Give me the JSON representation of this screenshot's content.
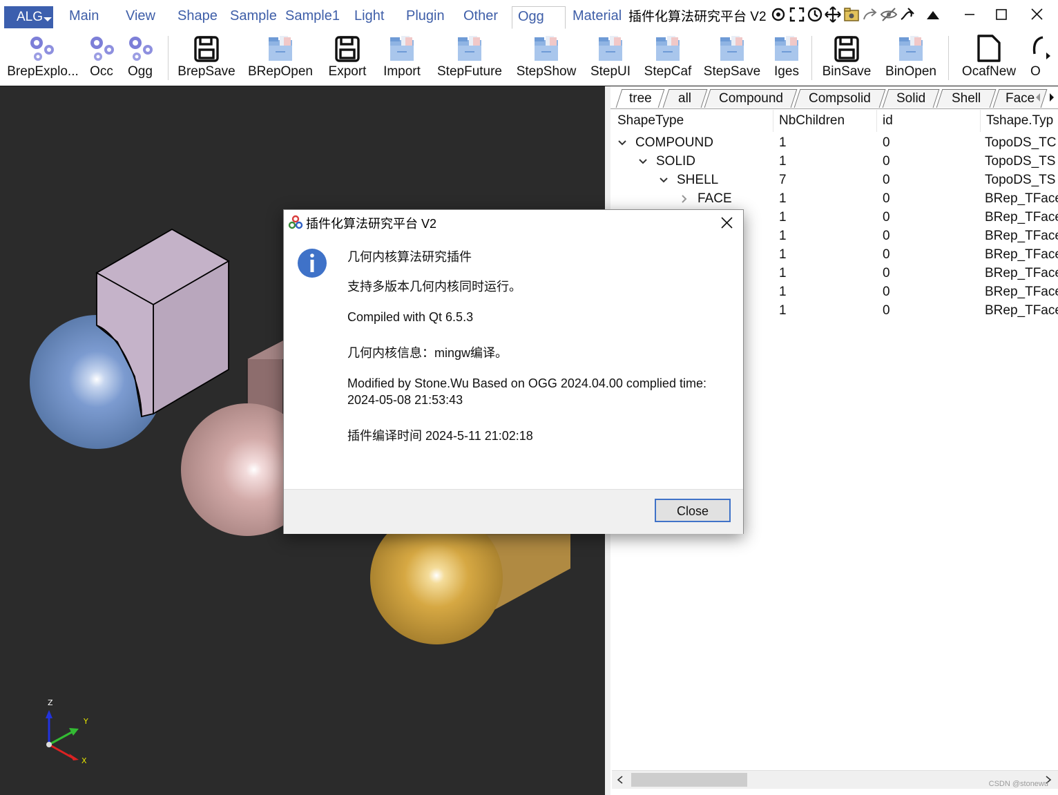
{
  "menubar": {
    "alg_label": "ALG",
    "tabs": [
      {
        "label": "Main"
      },
      {
        "label": "View"
      },
      {
        "label": "Shape"
      },
      {
        "label": "Sample"
      },
      {
        "label": "Sample1"
      },
      {
        "label": "Light"
      },
      {
        "label": "Plugin"
      },
      {
        "label": "Other"
      },
      {
        "label": "Ogg"
      },
      {
        "label": "Material"
      }
    ],
    "active_tab": "Ogg",
    "window_title": "插件化算法研究平台 V2",
    "accent_color": "#3c5fae"
  },
  "ribbon": {
    "buttons": [
      {
        "label": "BrepExplo...",
        "icon": "gears-icon"
      },
      {
        "label": "Occ",
        "icon": "gears-icon"
      },
      {
        "label": "Ogg",
        "icon": "gears-icon"
      },
      {
        "label": "BrepSave",
        "icon": "save-icon"
      },
      {
        "label": "BRepOpen",
        "icon": "folder-icon"
      },
      {
        "label": "Export",
        "icon": "save-icon"
      },
      {
        "label": "Import",
        "icon": "folder-icon"
      },
      {
        "label": "StepFuture",
        "icon": "folder-icon"
      },
      {
        "label": "StepShow",
        "icon": "folder-icon"
      },
      {
        "label": "StepUI",
        "icon": "folder-icon"
      },
      {
        "label": "StepCaf",
        "icon": "folder-icon"
      },
      {
        "label": "StepSave",
        "icon": "folder-icon"
      },
      {
        "label": "Iges",
        "icon": "folder-icon"
      },
      {
        "label": "BinSave",
        "icon": "save-icon"
      },
      {
        "label": "BinOpen",
        "icon": "folder-icon"
      },
      {
        "label": "OcafNew",
        "icon": "new-document-icon"
      },
      {
        "label": "O",
        "icon": "open-icon"
      }
    ]
  },
  "viewer": {
    "axis_labels": {
      "z": "Z",
      "y": "Y",
      "x": "X"
    }
  },
  "panel": {
    "tabs": [
      {
        "label": "tree"
      },
      {
        "label": "all"
      },
      {
        "label": "Compound"
      },
      {
        "label": "Compsolid"
      },
      {
        "label": "Solid"
      },
      {
        "label": "Shell"
      },
      {
        "label": "Face"
      }
    ],
    "active_tab": "tree",
    "columns": [
      "ShapeType",
      "NbChildren",
      "id",
      "Tshape.Typ"
    ],
    "rows": [
      {
        "type": "COMPOUND",
        "children": "1",
        "id": "0",
        "tshape": "TopoDS_TC",
        "level": 0,
        "expander": "expanded"
      },
      {
        "type": "SOLID",
        "children": "1",
        "id": "0",
        "tshape": "TopoDS_TS",
        "level": 1,
        "expander": "expanded"
      },
      {
        "type": "SHELL",
        "children": "7",
        "id": "0",
        "tshape": "TopoDS_TS",
        "level": 2,
        "expander": "expanded"
      },
      {
        "type": "FACE",
        "children": "1",
        "id": "0",
        "tshape": "BRep_TFace",
        "level": 3,
        "expander": "collapsed"
      },
      {
        "type": "",
        "children": "1",
        "id": "0",
        "tshape": "BRep_TFace",
        "level": 3,
        "expander": "none"
      },
      {
        "type": "",
        "children": "1",
        "id": "0",
        "tshape": "BRep_TFace",
        "level": 3,
        "expander": "none"
      },
      {
        "type": "",
        "children": "1",
        "id": "0",
        "tshape": "BRep_TFace",
        "level": 3,
        "expander": "none"
      },
      {
        "type": "",
        "children": "1",
        "id": "0",
        "tshape": "BRep_TFace",
        "level": 3,
        "expander": "none"
      },
      {
        "type": "",
        "children": "1",
        "id": "0",
        "tshape": "BRep_TFace",
        "level": 3,
        "expander": "none"
      },
      {
        "type": "",
        "children": "1",
        "id": "0",
        "tshape": "BRep_TFace",
        "level": 3,
        "expander": "none"
      }
    ],
    "watermark": "CSDN @stonewu"
  },
  "dialog": {
    "title": "插件化算法研究平台 V2",
    "lines": {
      "heading": "几何内核算法研究插件",
      "multi_version": "支持多版本几何内核同时运行。",
      "compiled": "Compiled with Qt 6.5.3",
      "kernel_info": "几何内核信息：mingw编译。",
      "modified_1": "Modified by Stone.Wu Based on OGG 2024.04.00 complied time:",
      "modified_2": "2024-05-08 21:53:43",
      "plugin_time": "插件编译时间 2024-5-11 21:02:18"
    },
    "close_label": "Close"
  }
}
